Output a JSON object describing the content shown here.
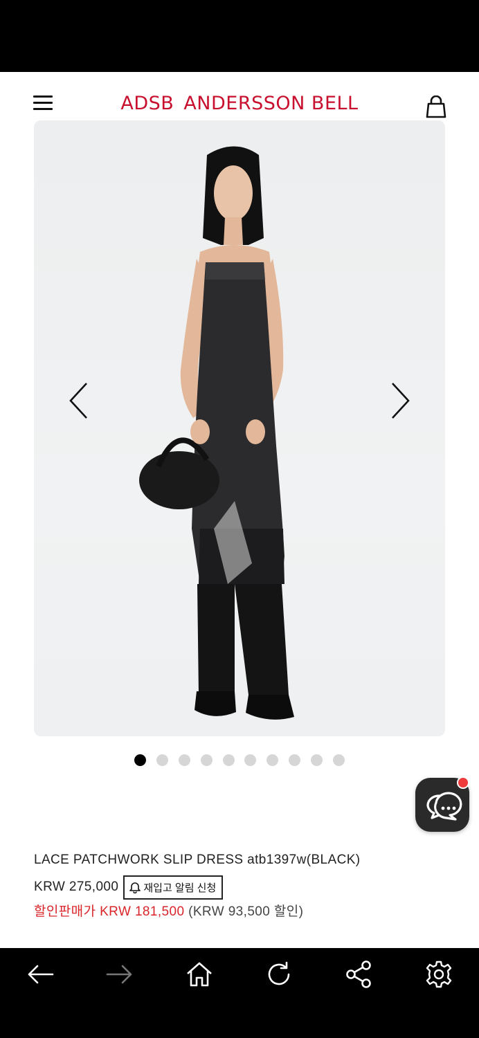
{
  "header": {
    "brand_prefix": "ADSB",
    "brand_name": "ANDERSSON BELL"
  },
  "gallery": {
    "total_images": 10,
    "active_index": 0
  },
  "product": {
    "name": "LACE PATCHWORK SLIP DRESS atb1397w(BLACK)",
    "price_original": "KRW 275,000",
    "restock_label": "재입고 알림 신청",
    "sale_label": "할인판매가",
    "sale_price": "KRW 181,500",
    "sale_diff": "(KRW 93,500 할인)"
  },
  "colors": {
    "brand": "#c8102e",
    "sale": "#d9252a",
    "badge": "#ef3b3b"
  },
  "icons": {
    "menu": "hamburger-menu-icon",
    "bag": "shopping-bag-icon",
    "prev": "chevron-left-icon",
    "next": "chevron-right-icon",
    "chat": "chat-bubbles-icon",
    "bell": "bell-icon",
    "nav_back": "arrow-left-icon",
    "nav_forward": "arrow-right-icon",
    "nav_home": "home-icon",
    "nav_reload": "reload-icon",
    "nav_share": "share-icon",
    "nav_settings": "gear-icon"
  }
}
